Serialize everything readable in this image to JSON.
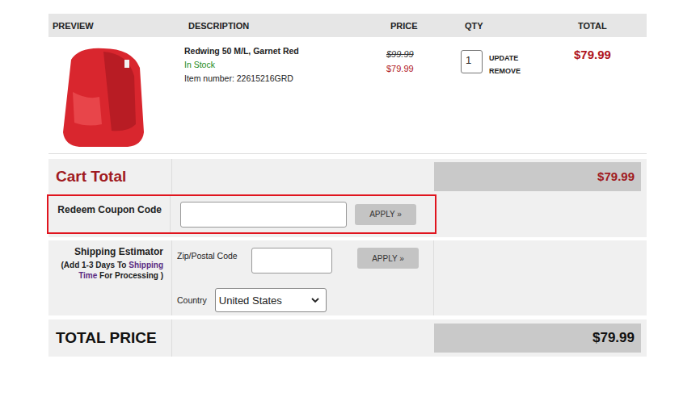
{
  "columns": [
    "PREVIEW",
    "DESCRIPTION",
    "PRICE",
    "QTY",
    "TOTAL"
  ],
  "item": {
    "name": "Redwing 50 M/L, Garnet Red",
    "stock": "In Stock",
    "item_number": "Item number: 22615216GRD",
    "old_price": "$99.99",
    "price": "$79.99",
    "qty": "1",
    "actions": [
      "UPDATE",
      "REMOVE"
    ],
    "total": "$79.99"
  },
  "cart_total": {
    "label": "Cart Total",
    "value": "$79.99"
  },
  "coupon": {
    "label": "Redeem Coupon Code",
    "value": "",
    "button": "APPLY »",
    "highlighted": true
  },
  "shipping": {
    "label": "Shipping Estimator",
    "note_lines": [
      [
        {
          "text": "(Add 1-3 Days To ",
          "link": false
        },
        {
          "text": "Shipping",
          "link": true
        }
      ],
      [
        {
          "text": "Time",
          "link": true
        },
        {
          "text": " For Processing )",
          "link": false
        }
      ]
    ],
    "zip_label": "Zip/Postal Code",
    "zip_value": "",
    "button": "APPLY »",
    "country_label": "Country",
    "country": "United States"
  },
  "total_price": {
    "label": "TOTAL PRICE",
    "value": "$79.99"
  }
}
